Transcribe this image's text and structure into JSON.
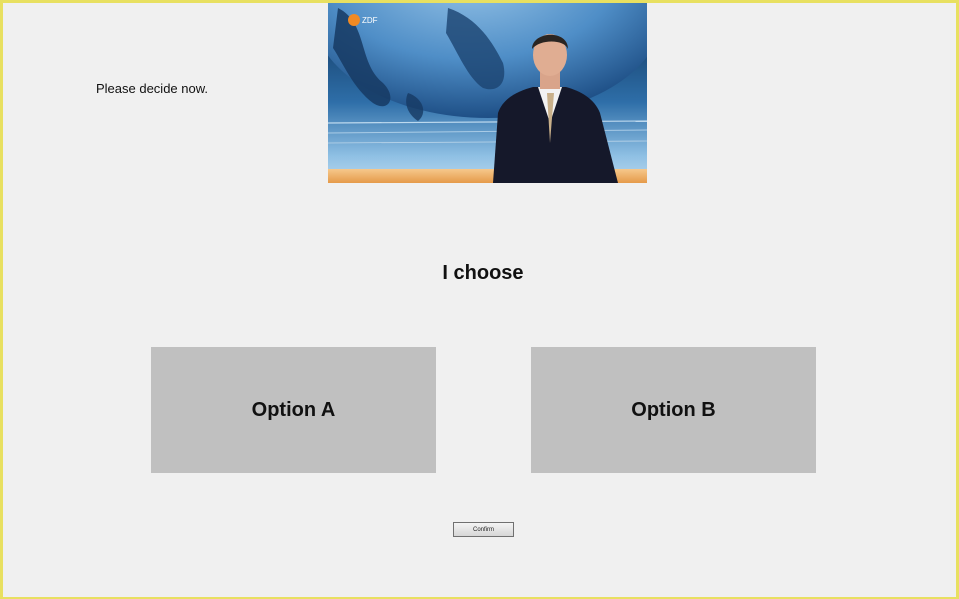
{
  "instruction": {
    "text": "Please decide now."
  },
  "video": {
    "channel_logo": "ZDF"
  },
  "prompt": {
    "title": "I choose"
  },
  "options": [
    {
      "label": "Option A"
    },
    {
      "label": "Option B"
    }
  ],
  "confirm": {
    "label": "Confirm"
  },
  "colors": {
    "background": "#f0f0f0",
    "frame_border": "#e8e060",
    "option_fill": "#c0c0c0"
  }
}
